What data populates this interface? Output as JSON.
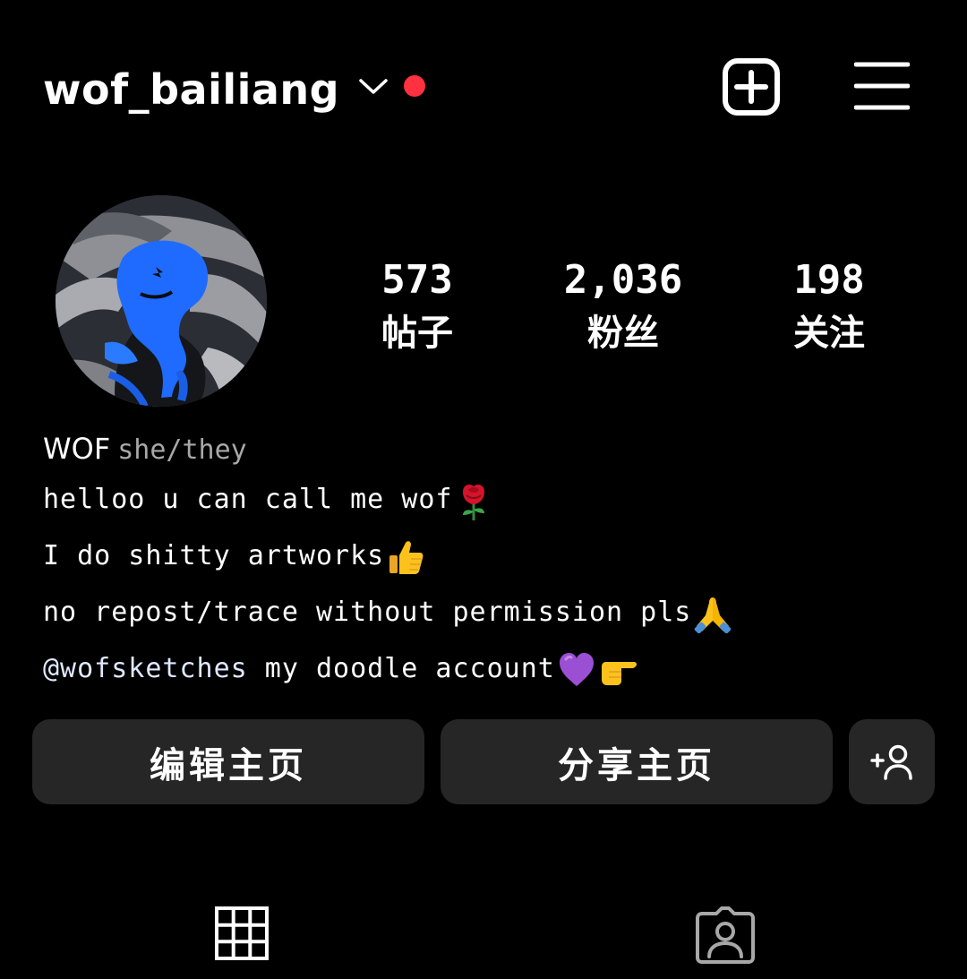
{
  "header": {
    "username": "wof_bailiang",
    "icons": {
      "dropdown": "chevron-down-icon",
      "notification": "notification-dot",
      "add": "add-post-icon",
      "menu": "hamburger-menu-icon"
    },
    "accent_red": "#ff3040"
  },
  "profile": {
    "avatar": "avatar",
    "stats": [
      {
        "value": "573",
        "label": "帖子"
      },
      {
        "value": "2,036",
        "label": "粉丝"
      },
      {
        "value": "198",
        "label": "关注"
      }
    ]
  },
  "bio": {
    "name": "WOF",
    "pronouns": "she/they",
    "lines": [
      {
        "text": "helloo u can call me wof",
        "emoji": "rose"
      },
      {
        "text": "I do shitty artworks",
        "emoji": "thumbs-up"
      },
      {
        "text": "no repost/trace without permission pls",
        "emoji": "folded-hands"
      }
    ],
    "mention_line": {
      "mention": "@wofsketches",
      "text": " my doodle account",
      "emojis": [
        "purple-heart",
        "pointing-right"
      ]
    }
  },
  "buttons": {
    "edit_profile": "编辑主页",
    "share_profile": "分享主页",
    "add_user_icon": "add-person-icon"
  },
  "tabs": {
    "grid_icon": "grid-icon",
    "tagged_icon": "tagged-person-icon"
  }
}
